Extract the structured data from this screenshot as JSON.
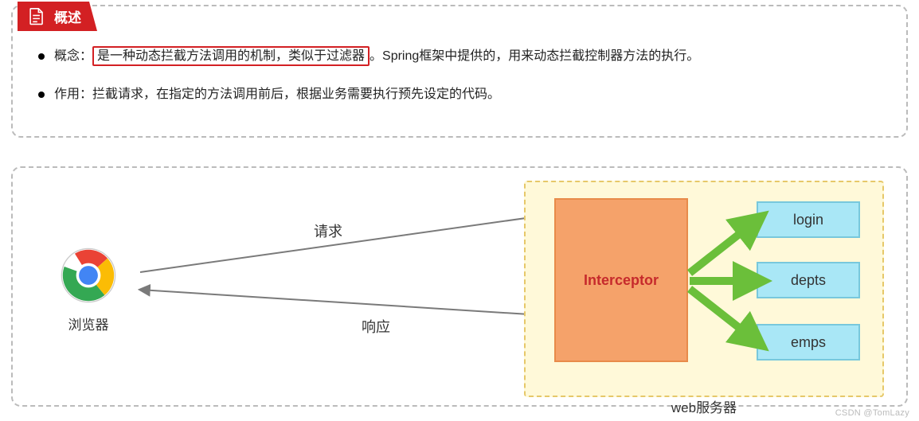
{
  "header": {
    "title": "概述"
  },
  "bullets": {
    "b1_prefix": "概念：",
    "b1_highlight": "是一种动态拦截方法调用的机制，类似于过滤器",
    "b1_suffix": "。Spring框架中提供的，用来动态拦截控制器方法的执行。",
    "b2": "作用：拦截请求，在指定的方法调用前后，根据业务需要执行预先设定的代码。"
  },
  "diagram": {
    "browser_label": "浏览器",
    "request_label": "请求",
    "response_label": "响应",
    "interceptor_label": "Interceptor",
    "web_server_label": "web服务器",
    "endpoints": {
      "login": "login",
      "depts": "depts",
      "emps": "emps"
    }
  },
  "watermark": "CSDN @TomLazy"
}
